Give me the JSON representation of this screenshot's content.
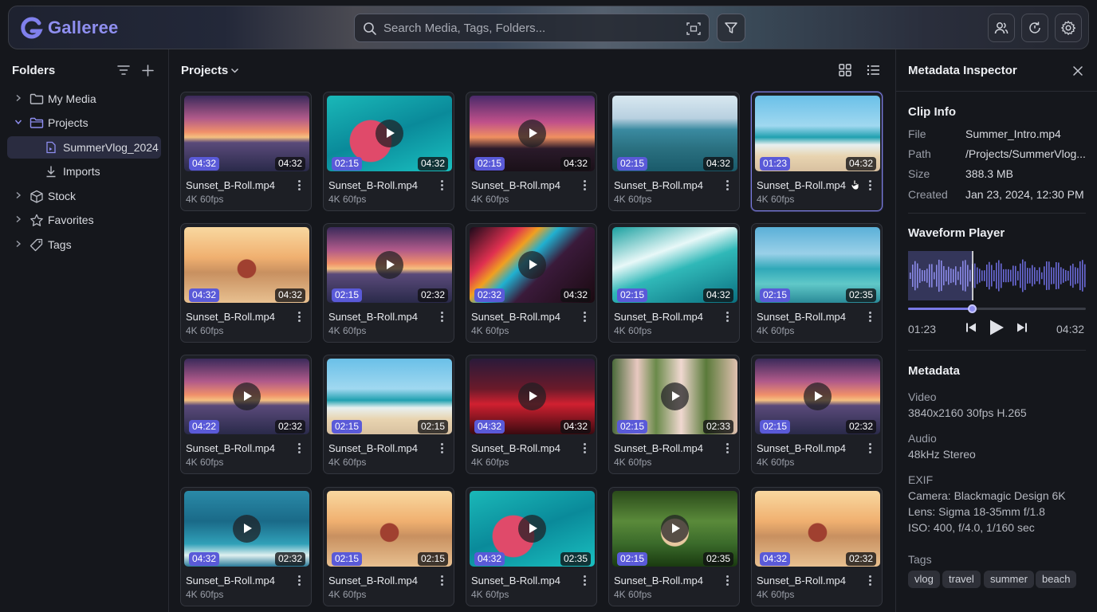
{
  "app": {
    "name": "Galleree",
    "accent": "#7a7ae6"
  },
  "search": {
    "placeholder": "Search Media, Tags, Folders..."
  },
  "sidebar": {
    "title": "Folders",
    "items": [
      {
        "label": "My Media",
        "icon": "folder-icon",
        "expanded": false
      },
      {
        "label": "Projects",
        "icon": "folder-open-icon",
        "expanded": true
      },
      {
        "label": "SummerVlog_2024",
        "icon": "file-video-icon",
        "selected": true
      },
      {
        "label": "Imports",
        "icon": "download-icon"
      },
      {
        "label": "Stock",
        "icon": "cube-icon",
        "expanded": false
      },
      {
        "label": "Favorites",
        "icon": "star-icon",
        "expanded": false
      },
      {
        "label": "Tags",
        "icon": "tag-icon",
        "expanded": false
      }
    ]
  },
  "main": {
    "title": "Projects",
    "cards": [
      {
        "name": "Sunset_B-Roll.mp4",
        "meta": "4K 60fps",
        "badge": "04:32",
        "duration": "04:32",
        "play": false,
        "scene": "sunset-sea"
      },
      {
        "name": "Sunset_B-Roll.mp4",
        "meta": "4K 60fps",
        "badge": "02:15",
        "duration": "04:32",
        "play": true,
        "scene": "pool-board"
      },
      {
        "name": "Sunset_B-Roll.mp4",
        "meta": "4K 60fps",
        "badge": "02:15",
        "duration": "04:32",
        "play": true,
        "scene": "palms"
      },
      {
        "name": "Sunset_B-Roll.mp4",
        "meta": "4K 60fps",
        "badge": "02:15",
        "duration": "04:32",
        "play": false,
        "scene": "jump"
      },
      {
        "name": "Sunset_B-Roll.mp4",
        "meta": "4K 60fps",
        "badge": "01:23",
        "duration": "04:32",
        "play": false,
        "scene": "beach-walk",
        "selected": true
      },
      {
        "name": "Sunset_B-Roll.mp4",
        "meta": "4K 60fps",
        "badge": "04:32",
        "duration": "04:32",
        "play": false,
        "scene": "golden-girl"
      },
      {
        "name": "Sunset_B-Roll.mp4",
        "meta": "4K 60fps",
        "badge": "02:15",
        "duration": "02:32",
        "play": true,
        "scene": "sunset-sea"
      },
      {
        "name": "Sunset_B-Roll.mp4",
        "meta": "4K 60fps",
        "badge": "02:32",
        "duration": "04:32",
        "play": true,
        "scene": "neon-street"
      },
      {
        "name": "Sunset_B-Roll.mp4",
        "meta": "4K 60fps",
        "badge": "02:15",
        "duration": "04:32",
        "play": false,
        "scene": "surf"
      },
      {
        "name": "Sunset_B-Roll.mp4",
        "meta": "4K 60fps",
        "badge": "02:15",
        "duration": "02:35",
        "play": false,
        "scene": "surf-walk"
      },
      {
        "name": "Sunset_B-Roll.mp4",
        "meta": "4K 60fps",
        "badge": "04:22",
        "duration": "02:32",
        "play": true,
        "scene": "sunset-sea"
      },
      {
        "name": "Sunset_B-Roll.mp4",
        "meta": "4K 60fps",
        "badge": "02:15",
        "duration": "02:15",
        "play": false,
        "scene": "beach-walk"
      },
      {
        "name": "Sunset_B-Roll.mp4",
        "meta": "4K 60fps",
        "badge": "04:32",
        "duration": "04:32",
        "play": true,
        "scene": "red-street"
      },
      {
        "name": "Sunset_B-Roll.mp4",
        "meta": "4K 60fps",
        "badge": "02:15",
        "duration": "02:33",
        "play": true,
        "scene": "cactus"
      },
      {
        "name": "Sunset_B-Roll.mp4",
        "meta": "4K 60fps",
        "badge": "02:15",
        "duration": "02:32",
        "play": true,
        "scene": "sunset-sea"
      },
      {
        "name": "Sunset_B-Roll.mp4",
        "meta": "4K 60fps",
        "badge": "04:32",
        "duration": "02:32",
        "play": true,
        "scene": "surf-sea"
      },
      {
        "name": "Sunset_B-Roll.mp4",
        "meta": "4K 60fps",
        "badge": "02:15",
        "duration": "02:15",
        "play": false,
        "scene": "golden-girl"
      },
      {
        "name": "Sunset_B-Roll.mp4",
        "meta": "4K 60fps",
        "badge": "04:32",
        "duration": "02:35",
        "play": true,
        "scene": "pool-board"
      },
      {
        "name": "Sunset_B-Roll.mp4",
        "meta": "4K 60fps",
        "badge": "02:15",
        "duration": "02:35",
        "play": true,
        "scene": "jungle"
      },
      {
        "name": "Sunset_B-Roll.mp4",
        "meta": "4K 60fps",
        "badge": "04:32",
        "duration": "02:32",
        "play": false,
        "scene": "golden-girl"
      }
    ]
  },
  "inspector": {
    "title": "Metadata Inspector",
    "clip_info": {
      "title": "Clip Info",
      "rows": [
        {
          "key": "File",
          "value": "Summer_Intro.mp4"
        },
        {
          "key": "Path",
          "value": "/Projects/SummerVlog..."
        },
        {
          "key": "Size",
          "value": "388.3 MB"
        },
        {
          "key": "Created",
          "value": "Jan 23, 2024, 12:30 PM"
        }
      ]
    },
    "waveform": {
      "title": "Waveform Player",
      "current": "01:23",
      "total": "04:32",
      "progress": 0.36
    },
    "metadata": {
      "title": "Metadata",
      "video_label": "Video",
      "video": "3840x2160 30fps H.265",
      "audio_label": "Audio",
      "audio": "48kHz Stereo",
      "exif_label": "EXIF",
      "camera": "Camera: Blackmagic Design 6K",
      "lens": "Lens: Sigma 18-35mm f/1.8",
      "iso": "ISO: 400, f/4.0, 1/160 sec"
    },
    "tags": {
      "title": "Tags",
      "items": [
        "vlog",
        "travel",
        "summer",
        "beach"
      ]
    }
  }
}
